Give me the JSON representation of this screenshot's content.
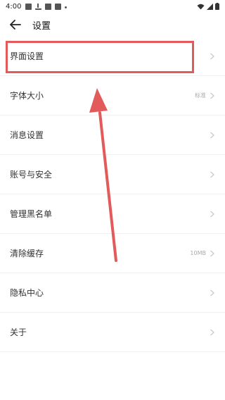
{
  "status_bar": {
    "time": "4:00",
    "icons_left": [
      "image-icon",
      "download-icon",
      "notification-icon",
      "notification-icon-2",
      "dot-icon"
    ],
    "icons_right": [
      "wifi-icon",
      "signal-icon",
      "battery-icon"
    ]
  },
  "header": {
    "back_icon": "back-arrow-icon",
    "title": "设置"
  },
  "settings": {
    "items": [
      {
        "label": "界面设置",
        "value": ""
      },
      {
        "label": "字体大小",
        "value": "标准"
      },
      {
        "label": "消息设置",
        "value": ""
      },
      {
        "label": "账号与安全",
        "value": ""
      },
      {
        "label": "管理黑名单",
        "value": ""
      },
      {
        "label": "清除缓存",
        "value": "10MB"
      },
      {
        "label": "隐私中心",
        "value": ""
      },
      {
        "label": "关于",
        "value": ""
      }
    ]
  },
  "annotation": {
    "highlight_color": "#e25a5a",
    "arrow_color": "#e25a5a"
  }
}
